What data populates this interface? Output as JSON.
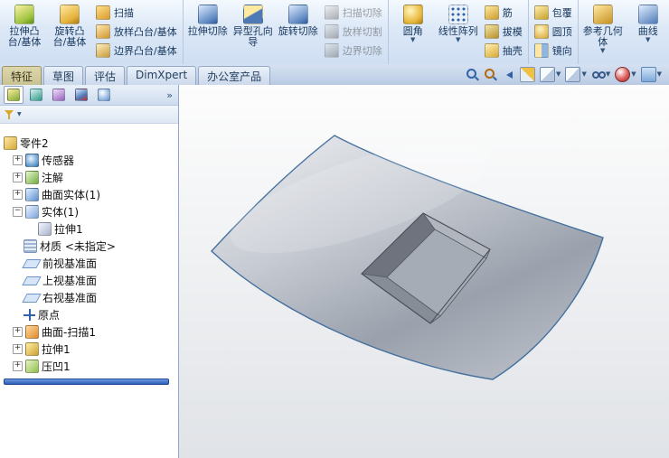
{
  "ribbon": {
    "extrude_boss": "拉伸凸台/基体",
    "revolve_boss": "旋转凸台/基体",
    "sweep": "扫描",
    "loft_boss": "放样凸台/基体",
    "boundary_boss": "边界凸台/基体",
    "extrude_cut": "拉伸切除",
    "hole_wizard": "异型孔向导",
    "revolve_cut": "旋转切除",
    "swept_cut": "扫描切除",
    "lofted_cut": "放样切割",
    "boundary_cut": "边界切除",
    "fillet": "圆角",
    "linear_pattern": "线性阵列",
    "rib": "筋",
    "draft": "拔模",
    "shell": "抽壳",
    "wrap": "包覆",
    "dome": "圆顶",
    "mirror": "镜向",
    "reference_geometry": "参考几何体",
    "curves": "曲线"
  },
  "tabs": {
    "features": "特征",
    "sketch": "草图",
    "evaluate": "评估",
    "dimxpert": "DimXpert",
    "office": "办公室产品"
  },
  "panel": {
    "expand": "»"
  },
  "icons": {
    "caret": "▼",
    "plus": "+",
    "minus": "−"
  },
  "tree": {
    "root": "零件2",
    "items": [
      {
        "label": "传感器"
      },
      {
        "label": "注解"
      },
      {
        "label": "曲面实体(1)"
      },
      {
        "label": "实体(1)"
      },
      {
        "label": "拉伸1"
      },
      {
        "label": "材质 <未指定>"
      },
      {
        "label": "前视基准面"
      },
      {
        "label": "上视基准面"
      },
      {
        "label": "右视基准面"
      },
      {
        "label": "原点"
      },
      {
        "label": "曲面-扫描1"
      },
      {
        "label": "拉伸1"
      },
      {
        "label": "压凹1"
      }
    ]
  },
  "colors": {
    "accent_blue": "#2c5eb5",
    "model_edge": "#44709e",
    "active_tab": "#cdc79c"
  }
}
